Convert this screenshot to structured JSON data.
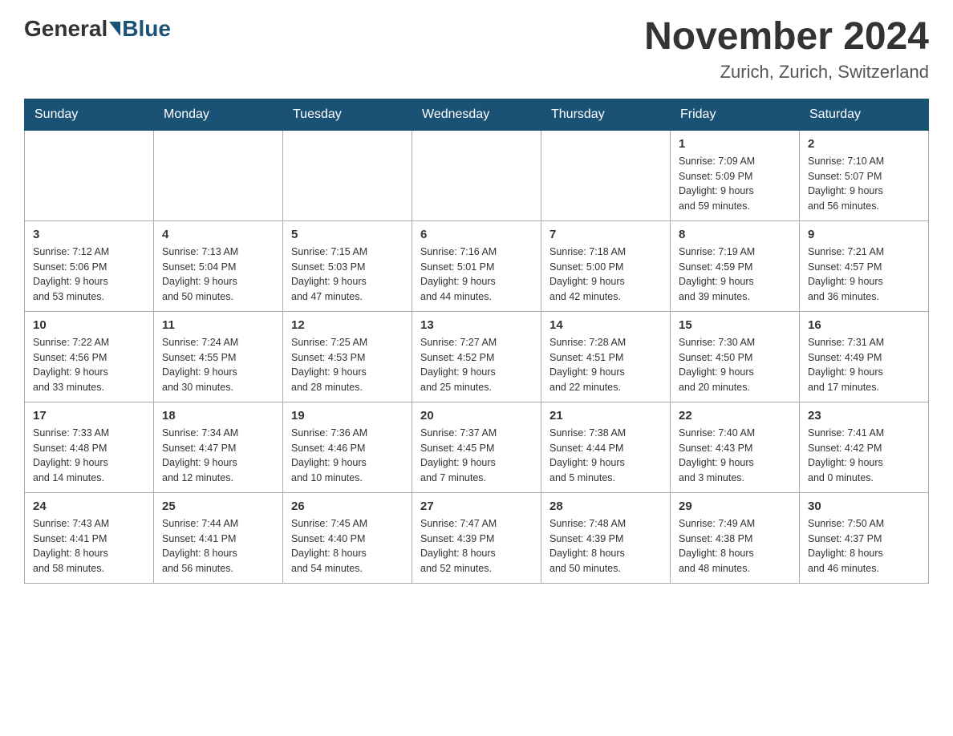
{
  "logo": {
    "general": "General",
    "blue": "Blue"
  },
  "title": {
    "month_year": "November 2024",
    "location": "Zurich, Zurich, Switzerland"
  },
  "days_of_week": [
    "Sunday",
    "Monday",
    "Tuesday",
    "Wednesday",
    "Thursday",
    "Friday",
    "Saturday"
  ],
  "weeks": [
    [
      {
        "day": "",
        "info": ""
      },
      {
        "day": "",
        "info": ""
      },
      {
        "day": "",
        "info": ""
      },
      {
        "day": "",
        "info": ""
      },
      {
        "day": "",
        "info": ""
      },
      {
        "day": "1",
        "info": "Sunrise: 7:09 AM\nSunset: 5:09 PM\nDaylight: 9 hours\nand 59 minutes."
      },
      {
        "day": "2",
        "info": "Sunrise: 7:10 AM\nSunset: 5:07 PM\nDaylight: 9 hours\nand 56 minutes."
      }
    ],
    [
      {
        "day": "3",
        "info": "Sunrise: 7:12 AM\nSunset: 5:06 PM\nDaylight: 9 hours\nand 53 minutes."
      },
      {
        "day": "4",
        "info": "Sunrise: 7:13 AM\nSunset: 5:04 PM\nDaylight: 9 hours\nand 50 minutes."
      },
      {
        "day": "5",
        "info": "Sunrise: 7:15 AM\nSunset: 5:03 PM\nDaylight: 9 hours\nand 47 minutes."
      },
      {
        "day": "6",
        "info": "Sunrise: 7:16 AM\nSunset: 5:01 PM\nDaylight: 9 hours\nand 44 minutes."
      },
      {
        "day": "7",
        "info": "Sunrise: 7:18 AM\nSunset: 5:00 PM\nDaylight: 9 hours\nand 42 minutes."
      },
      {
        "day": "8",
        "info": "Sunrise: 7:19 AM\nSunset: 4:59 PM\nDaylight: 9 hours\nand 39 minutes."
      },
      {
        "day": "9",
        "info": "Sunrise: 7:21 AM\nSunset: 4:57 PM\nDaylight: 9 hours\nand 36 minutes."
      }
    ],
    [
      {
        "day": "10",
        "info": "Sunrise: 7:22 AM\nSunset: 4:56 PM\nDaylight: 9 hours\nand 33 minutes."
      },
      {
        "day": "11",
        "info": "Sunrise: 7:24 AM\nSunset: 4:55 PM\nDaylight: 9 hours\nand 30 minutes."
      },
      {
        "day": "12",
        "info": "Sunrise: 7:25 AM\nSunset: 4:53 PM\nDaylight: 9 hours\nand 28 minutes."
      },
      {
        "day": "13",
        "info": "Sunrise: 7:27 AM\nSunset: 4:52 PM\nDaylight: 9 hours\nand 25 minutes."
      },
      {
        "day": "14",
        "info": "Sunrise: 7:28 AM\nSunset: 4:51 PM\nDaylight: 9 hours\nand 22 minutes."
      },
      {
        "day": "15",
        "info": "Sunrise: 7:30 AM\nSunset: 4:50 PM\nDaylight: 9 hours\nand 20 minutes."
      },
      {
        "day": "16",
        "info": "Sunrise: 7:31 AM\nSunset: 4:49 PM\nDaylight: 9 hours\nand 17 minutes."
      }
    ],
    [
      {
        "day": "17",
        "info": "Sunrise: 7:33 AM\nSunset: 4:48 PM\nDaylight: 9 hours\nand 14 minutes."
      },
      {
        "day": "18",
        "info": "Sunrise: 7:34 AM\nSunset: 4:47 PM\nDaylight: 9 hours\nand 12 minutes."
      },
      {
        "day": "19",
        "info": "Sunrise: 7:36 AM\nSunset: 4:46 PM\nDaylight: 9 hours\nand 10 minutes."
      },
      {
        "day": "20",
        "info": "Sunrise: 7:37 AM\nSunset: 4:45 PM\nDaylight: 9 hours\nand 7 minutes."
      },
      {
        "day": "21",
        "info": "Sunrise: 7:38 AM\nSunset: 4:44 PM\nDaylight: 9 hours\nand 5 minutes."
      },
      {
        "day": "22",
        "info": "Sunrise: 7:40 AM\nSunset: 4:43 PM\nDaylight: 9 hours\nand 3 minutes."
      },
      {
        "day": "23",
        "info": "Sunrise: 7:41 AM\nSunset: 4:42 PM\nDaylight: 9 hours\nand 0 minutes."
      }
    ],
    [
      {
        "day": "24",
        "info": "Sunrise: 7:43 AM\nSunset: 4:41 PM\nDaylight: 8 hours\nand 58 minutes."
      },
      {
        "day": "25",
        "info": "Sunrise: 7:44 AM\nSunset: 4:41 PM\nDaylight: 8 hours\nand 56 minutes."
      },
      {
        "day": "26",
        "info": "Sunrise: 7:45 AM\nSunset: 4:40 PM\nDaylight: 8 hours\nand 54 minutes."
      },
      {
        "day": "27",
        "info": "Sunrise: 7:47 AM\nSunset: 4:39 PM\nDaylight: 8 hours\nand 52 minutes."
      },
      {
        "day": "28",
        "info": "Sunrise: 7:48 AM\nSunset: 4:39 PM\nDaylight: 8 hours\nand 50 minutes."
      },
      {
        "day": "29",
        "info": "Sunrise: 7:49 AM\nSunset: 4:38 PM\nDaylight: 8 hours\nand 48 minutes."
      },
      {
        "day": "30",
        "info": "Sunrise: 7:50 AM\nSunset: 4:37 PM\nDaylight: 8 hours\nand 46 minutes."
      }
    ]
  ]
}
